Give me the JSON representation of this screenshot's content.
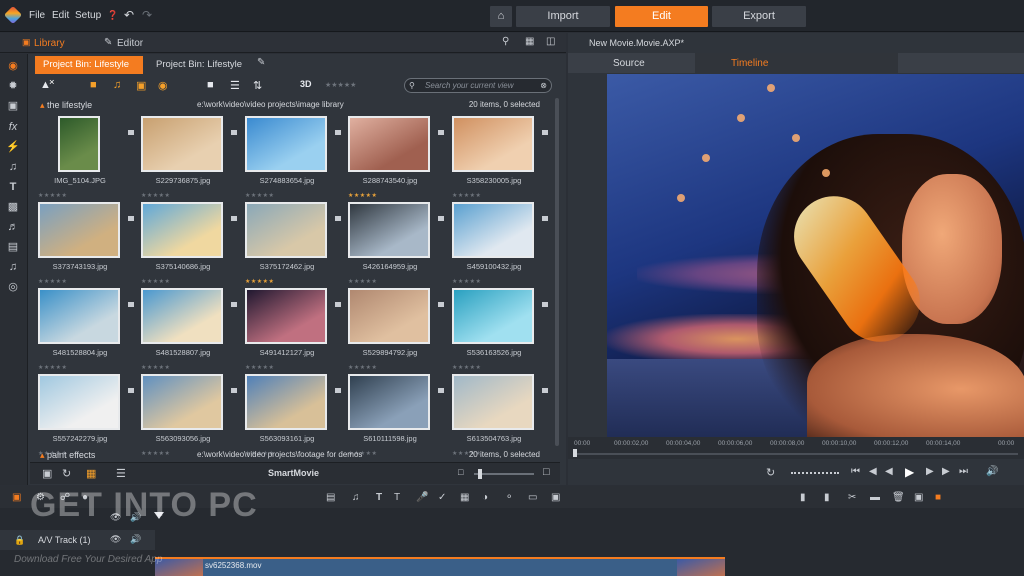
{
  "menubar": {
    "menus": [
      "File",
      "Edit",
      "Setup"
    ],
    "modes": {
      "import": "Import",
      "edit": "Edit",
      "export": "Export"
    },
    "colors": {
      "accent": "#f47c20",
      "bg": "#22262c"
    }
  },
  "tabs": {
    "library": "Library",
    "editor": "Editor",
    "project_title": "New Movie.Movie.AXP*"
  },
  "bins": {
    "active": "Project Bin: Lifestyle",
    "inactive": "Project Bin: Lifestyle"
  },
  "toolbar": {
    "3d_label": "3D",
    "search_placeholder": "Search your current view"
  },
  "sections": [
    {
      "name": "the lifestyle",
      "path": "e:\\work\\video\\video projects\\image library",
      "count": "20 items, 0 selected"
    },
    {
      "name": "paint effects",
      "path": "e:\\work\\video\\video projects\\footage for demos",
      "count": "20 items, 0 selected"
    }
  ],
  "media": [
    {
      "name": "IMG_5104.JPG",
      "rated": false
    },
    {
      "name": "S229736875.jpg",
      "rated": false
    },
    {
      "name": "S274883654.jpg",
      "rated": false
    },
    {
      "name": "S288743540.jpg",
      "rated": true
    },
    {
      "name": "S358230005.jpg",
      "rated": false
    },
    {
      "name": "S373743193.jpg",
      "rated": false
    },
    {
      "name": "S375140686.jpg",
      "rated": false
    },
    {
      "name": "S375172462.jpg",
      "rated": true
    },
    {
      "name": "S426164959.jpg",
      "rated": false
    },
    {
      "name": "S459100432.jpg",
      "rated": false
    },
    {
      "name": "S481528804.jpg",
      "rated": false
    },
    {
      "name": "S481528807.jpg",
      "rated": false
    },
    {
      "name": "S491412127.jpg",
      "rated": false
    },
    {
      "name": "S529894792.jpg",
      "rated": false
    },
    {
      "name": "S536163526.jpg",
      "rated": false
    },
    {
      "name": "S557242279.jpg",
      "rated": false
    },
    {
      "name": "S563093056.jpg",
      "rated": false
    },
    {
      "name": "S563093161.jpg",
      "rated": false
    },
    {
      "name": "S610111598.jpg",
      "rated": false
    },
    {
      "name": "S613504763.jpg",
      "rated": false
    }
  ],
  "bin_footer": {
    "label": "SmartMovie"
  },
  "viewer": {
    "source_tab": "Source",
    "timeline_tab": "Timeline"
  },
  "ruler": [
    "00:00",
    "00:00:02,00",
    "00:00:04,00",
    "00:00:06,00",
    "00:00:08,00",
    "00:00:10,00",
    "00:00:12,00",
    "00:00:14,00",
    "00:00"
  ],
  "timeline": {
    "track_label": "A/V Track (1)",
    "clip_name": "sv6252368.mov"
  },
  "watermark": {
    "main": "GET INTO PC",
    "sub": "Download Free Your Desired App"
  }
}
